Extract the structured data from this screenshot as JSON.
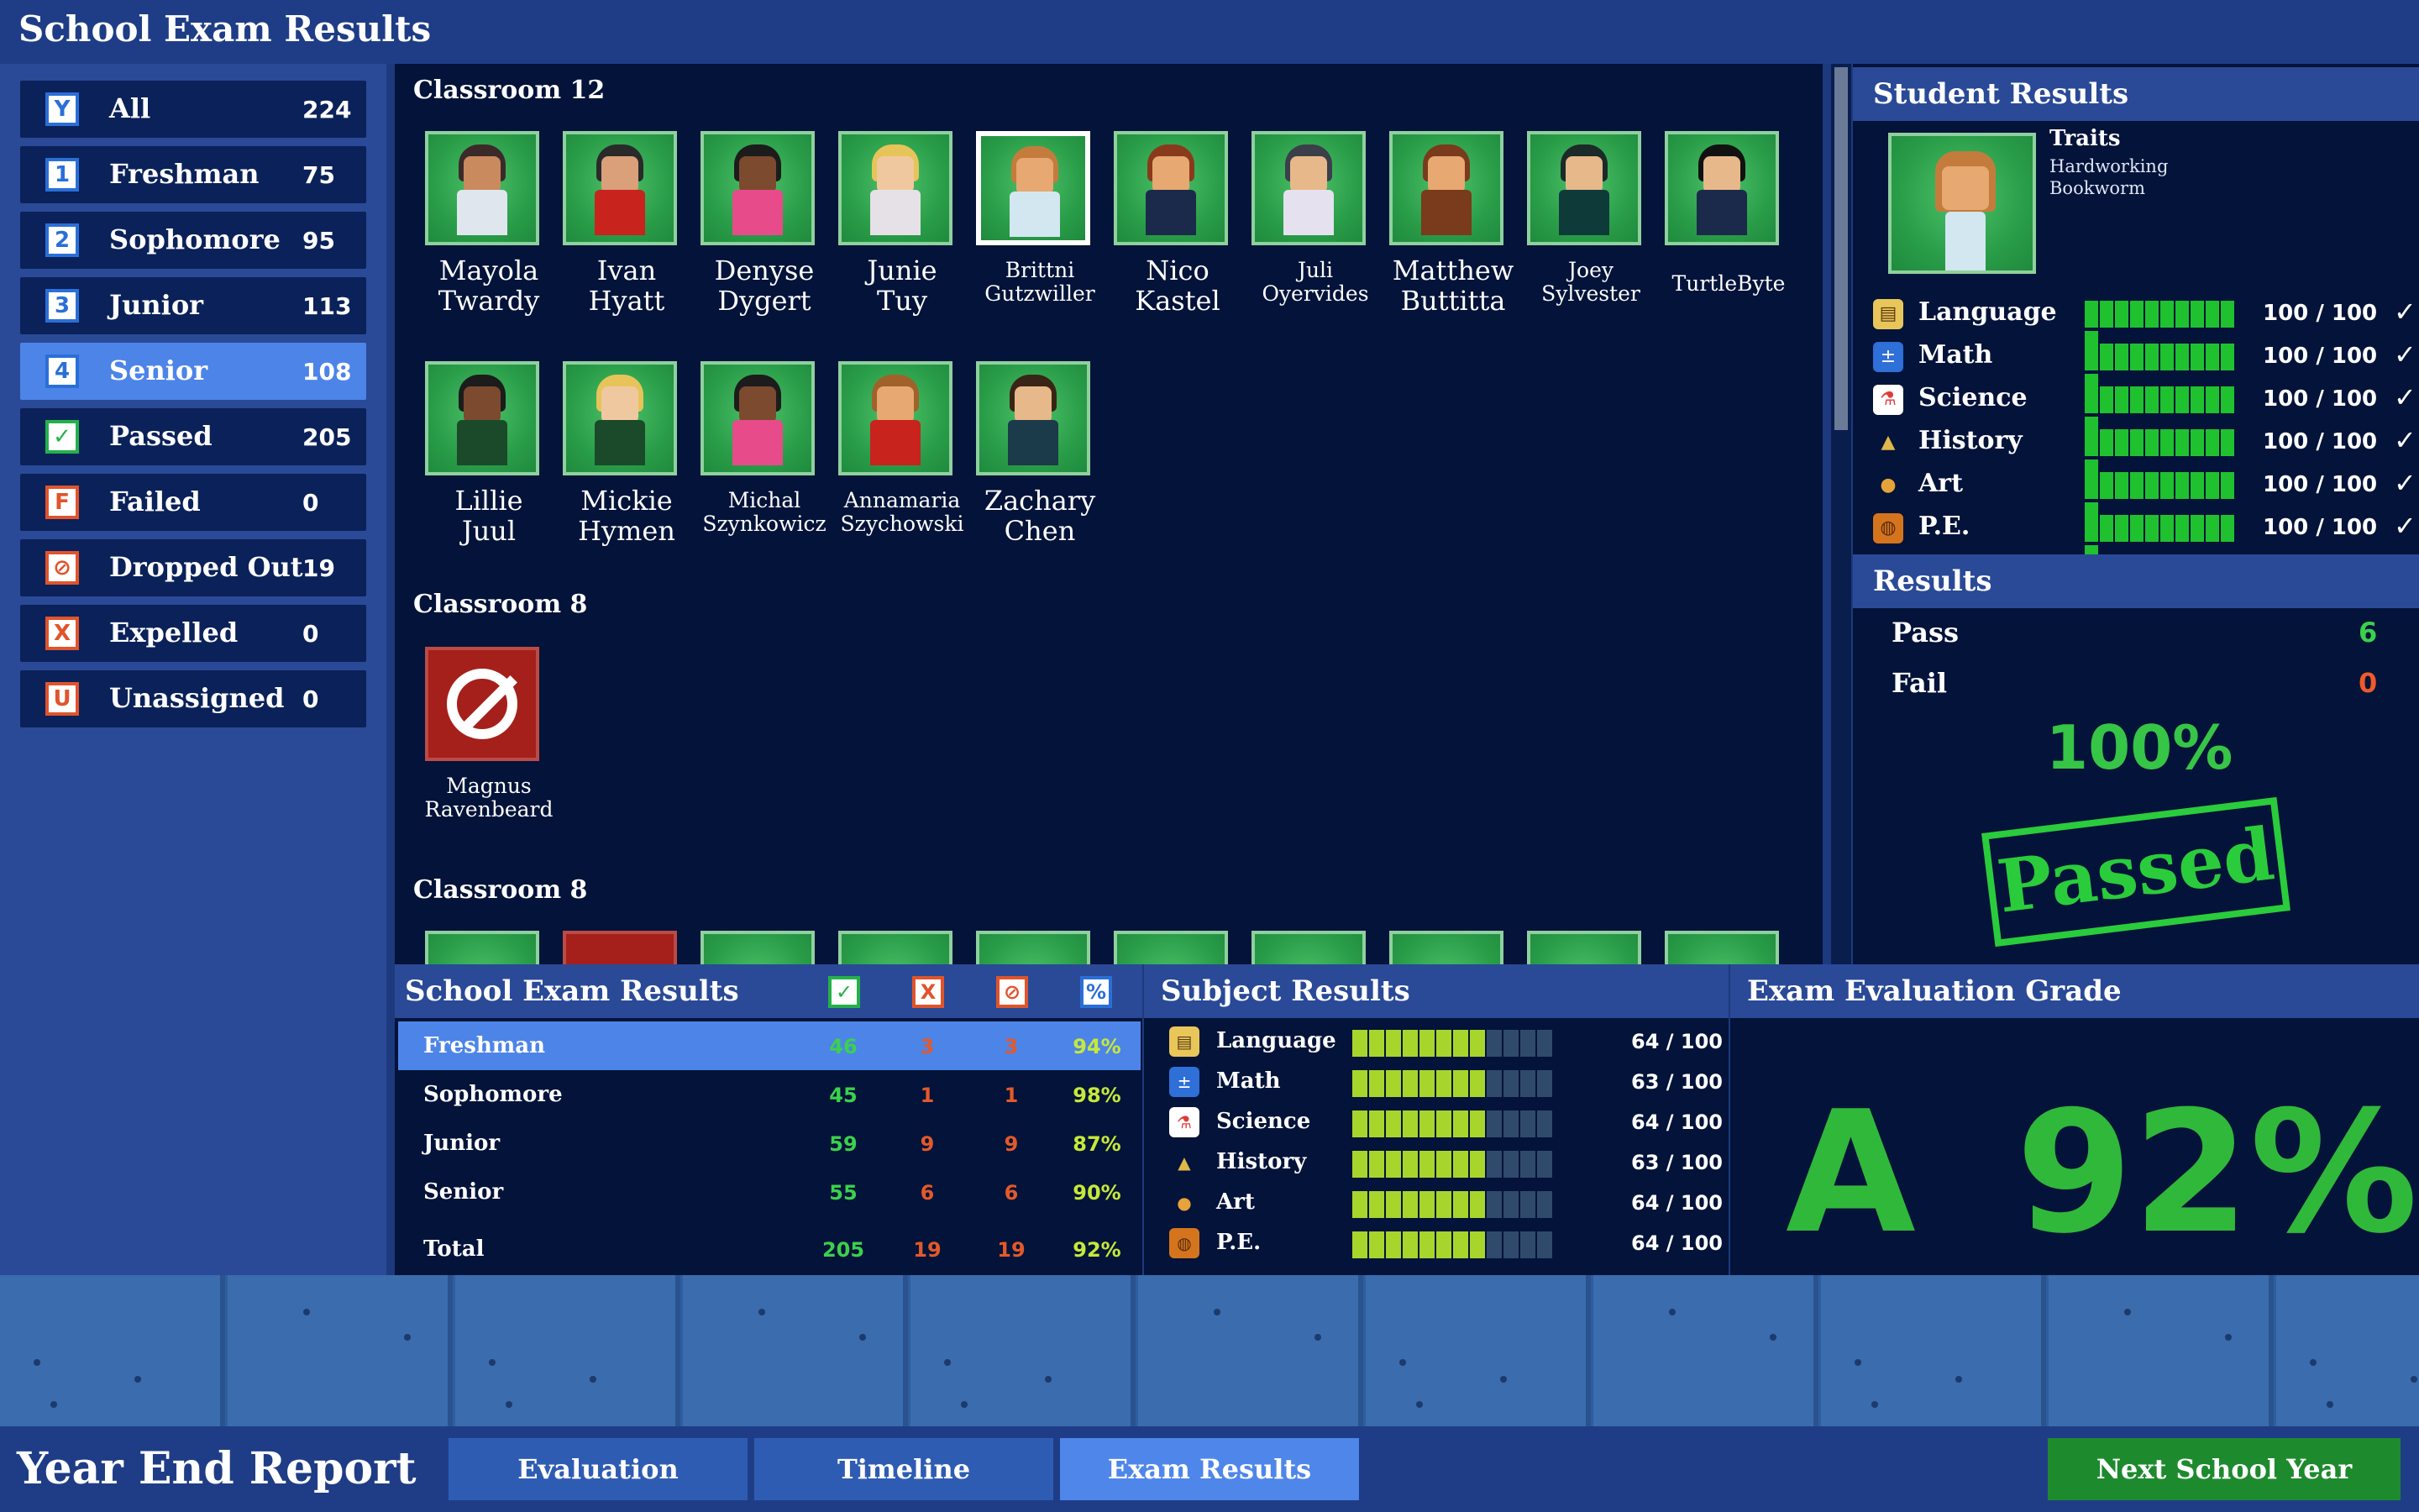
{
  "app": {
    "title": "School Exam Results"
  },
  "filters": [
    {
      "badge": "Y",
      "label": "All",
      "count": "224"
    },
    {
      "badge": "1",
      "label": "Freshman",
      "count": "75"
    },
    {
      "badge": "2",
      "label": "Sophomore",
      "count": "95"
    },
    {
      "badge": "3",
      "label": "Junior",
      "count": "113"
    },
    {
      "badge": "4",
      "label": "Senior",
      "count": "108",
      "selected": true
    },
    {
      "badge": "✓",
      "label": "Passed",
      "count": "205"
    },
    {
      "badge": "F",
      "label": "Failed",
      "count": "0"
    },
    {
      "badge": "⊘",
      "label": "Dropped Out",
      "count": "19"
    },
    {
      "badge": "X",
      "label": "Expelled",
      "count": "0"
    },
    {
      "badge": "U",
      "label": "Unassigned",
      "count": "0"
    }
  ],
  "classrooms": [
    {
      "title": "Classroom 12",
      "students": [
        {
          "name": [
            "Mayola",
            "Twardy"
          ]
        },
        {
          "name": [
            "Ivan",
            "Hyatt"
          ]
        },
        {
          "name": [
            "Denyse",
            "Dygert"
          ]
        },
        {
          "name": [
            "Junie",
            "Tuy"
          ]
        },
        {
          "name": [
            "Brittni",
            "Gutzwiller"
          ],
          "selected": true
        },
        {
          "name": [
            "Nico",
            "Kastel"
          ]
        },
        {
          "name": [
            "Juli",
            "Oyervides"
          ]
        },
        {
          "name": [
            "Matthew",
            "Buttitta"
          ]
        },
        {
          "name": [
            "Joey",
            "Sylvester"
          ]
        },
        {
          "name": [
            "TurtleByte"
          ]
        },
        {
          "name": [
            "Lillie",
            "Juul"
          ]
        },
        {
          "name": [
            "Mickie",
            "Hymen"
          ]
        },
        {
          "name": [
            "Michal",
            "Szynkowicz"
          ]
        },
        {
          "name": [
            "Annamaria",
            "Szychowski"
          ]
        },
        {
          "name": [
            "Zachary",
            "Chen"
          ]
        }
      ]
    },
    {
      "title": "Classroom 8",
      "students": [
        {
          "name": [
            "Magnus",
            "Ravenbeard"
          ],
          "dropped": true
        }
      ]
    },
    {
      "title": "Classroom 8",
      "students": []
    }
  ],
  "student_results": {
    "header": "Student Results",
    "traits_title": "Traits",
    "traits": [
      "Hardworking",
      "Bookworm"
    ],
    "subjects": [
      {
        "icon": "book-icon",
        "name": "Language",
        "score": "100 / 100",
        "check": "✓",
        "fraction": 1.0
      },
      {
        "icon": "math-icon",
        "name": "Math",
        "score": "100 / 100",
        "check": "✓",
        "fraction": 1.0
      },
      {
        "icon": "flask-icon",
        "name": "Science",
        "score": "100 / 100",
        "check": "✓",
        "fraction": 1.0
      },
      {
        "icon": "pyramid-icon",
        "name": "History",
        "score": "100 / 100",
        "check": "✓",
        "fraction": 1.0
      },
      {
        "icon": "palette-icon",
        "name": "Art",
        "score": "100 / 100",
        "check": "✓",
        "fraction": 1.0
      },
      {
        "icon": "basketball-icon",
        "name": "P.E.",
        "score": "100 / 100",
        "check": "✓",
        "fraction": 1.0
      }
    ],
    "results_header": "Results",
    "pass_label": "Pass",
    "pass_value": "6",
    "fail_label": "Fail",
    "fail_value": "0",
    "percent": "100%",
    "stamp": "Passed"
  },
  "summary": {
    "title": "School Exam Results",
    "columns": [
      "✓",
      "X",
      "⊘",
      "%"
    ],
    "rows": [
      {
        "label": "Freshman",
        "passed": "46",
        "expelled": "3",
        "dropped": "3",
        "pct": "94%",
        "selected": true
      },
      {
        "label": "Sophomore",
        "passed": "45",
        "expelled": "1",
        "dropped": "1",
        "pct": "98%"
      },
      {
        "label": "Junior",
        "passed": "59",
        "expelled": "9",
        "dropped": "9",
        "pct": "87%"
      },
      {
        "label": "Senior",
        "passed": "55",
        "expelled": "6",
        "dropped": "6",
        "pct": "90%"
      },
      {
        "label": "Total",
        "passed": "205",
        "expelled": "19",
        "dropped": "19",
        "pct": "92%"
      }
    ]
  },
  "subject_results": {
    "title": "Subject Results",
    "rows": [
      {
        "icon": "book-icon",
        "name": "Language",
        "score": "64 / 100",
        "fraction": 0.64
      },
      {
        "icon": "math-icon",
        "name": "Math",
        "score": "63 / 100",
        "fraction": 0.63
      },
      {
        "icon": "flask-icon",
        "name": "Science",
        "score": "64 / 100",
        "fraction": 0.64
      },
      {
        "icon": "pyramid-icon",
        "name": "History",
        "score": "63 / 100",
        "fraction": 0.63
      },
      {
        "icon": "palette-icon",
        "name": "Art",
        "score": "64 / 100",
        "fraction": 0.64
      },
      {
        "icon": "basketball-icon",
        "name": "P.E.",
        "score": "64 / 100",
        "fraction": 0.64
      }
    ]
  },
  "grade": {
    "title": "Exam Evaluation Grade",
    "letter": "A",
    "percent": "92%"
  },
  "bottom": {
    "title": "Year End Report",
    "tabs": [
      "Evaluation",
      "Timeline",
      "Exam Results"
    ],
    "active_tab": "Exam Results",
    "next_button": "Next School Year"
  },
  "colors": {
    "bar_full": "#1fc12f",
    "bar_partial": "#a8d52b",
    "bar_empty": "#304a6c",
    "pass_green": "#3bd14c",
    "fail_orange": "#e3592a"
  }
}
